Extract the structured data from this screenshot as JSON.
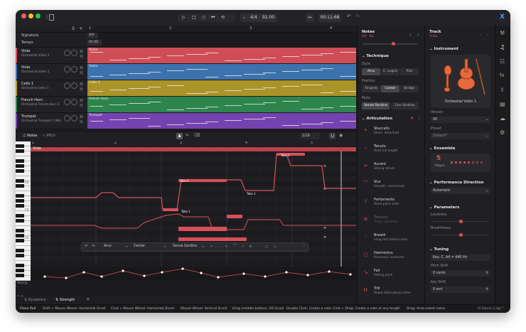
{
  "transport": {
    "time_signature": "4/4",
    "tempo": "92.00",
    "position": "00:11:68"
  },
  "timeline": {
    "bars": [
      "1",
      "2",
      "3",
      "4"
    ],
    "signature_label": "Signature",
    "signature_value": "4/4",
    "tempo_label": "Tempo",
    "tempo_value": "92.00"
  },
  "tracks": [
    {
      "name": "Viola",
      "instrument": "Orchestral Violin 1",
      "color": "#d9505a",
      "clip": "Violin"
    },
    {
      "name": "Viola",
      "instrument": "Orchestral Violin 1",
      "color": "#3f78b5",
      "clip": "Violin"
    },
    {
      "name": "Cello 1",
      "instrument": "Orchestral Cello 1",
      "color": "#b39a2a",
      "clip": "Cello 1"
    },
    {
      "name": "French Horn",
      "instrument": "Orchestral French Horn 1",
      "color": "#2f8a4f",
      "clip": "French Horn"
    },
    {
      "name": "Trumpet",
      "instrument": "Orchestral Trumpet 1 (Bb)",
      "color": "#7a46b8",
      "clip": "Trumpet"
    }
  ],
  "editor": {
    "tabs": [
      "Notes",
      "Pitch"
    ],
    "grid": "1/16",
    "bars": [
      "1",
      "2",
      "3",
      "4",
      "5"
    ],
    "clip_label": "Viola",
    "key_labels": [
      "C6",
      "C5",
      "C4"
    ],
    "note_labels": [
      "Take 1",
      "Take 2",
      "Take 1",
      "Take 1"
    ],
    "float_toolbar": {
      "articulation": "Arco",
      "position": "Center",
      "mute": "Senza Sordino"
    },
    "lane_label": "Strong",
    "lane_label2": "Soft",
    "bottom_tabs": [
      "Dynamics",
      "Strength"
    ]
  },
  "notes_panel": {
    "title": "Notes",
    "subtitle": "A4 · Bb",
    "technique_title": "Technique",
    "style_label": "Style",
    "style_options": [
      "Arco",
      "C. Legno",
      "Pizz"
    ],
    "position_label": "Position",
    "position_options": [
      "Fingerb",
      "Center",
      "Bridge"
    ],
    "mute_label": "Mute",
    "mute_options": [
      "Senza Sordino",
      "Con Sordino"
    ],
    "articulation_title": "Articulation",
    "articulations": [
      {
        "name": "Staccato",
        "desc": "Short, detached",
        "icon": "•"
      },
      {
        "name": "Tenuto",
        "desc": "Held full length",
        "icon": "–"
      },
      {
        "name": "Accent",
        "desc": "Strong attack",
        "icon": ">"
      },
      {
        "name": "Slur",
        "desc": "Smooth, connected",
        "icon": "⌒"
      },
      {
        "name": "Portamento",
        "desc": "Bend pitch slide",
        "icon": "/"
      },
      {
        "name": "Tremolo",
        "desc": "Rapid repetition",
        "icon": "≡"
      },
      {
        "name": "Breath",
        "desc": "Long rest before note",
        "icon": "◦"
      },
      {
        "name": "Harmonics",
        "desc": "Harmonic overtone",
        "icon": "○"
      },
      {
        "name": "Fall",
        "desc": "Falling pitch",
        "icon": "↘"
      },
      {
        "name": "Trill",
        "desc": "Rapid alternating notes",
        "icon": "tr"
      }
    ]
  },
  "track_panel": {
    "title": "Track",
    "subtitle": "Viola",
    "instrument_title": "Instrument",
    "instrument_name": "Orchestral Violin 1",
    "version_label": "Version",
    "version_value": "90",
    "preset_label": "Preset",
    "preset_value": "Default*",
    "ensemble_title": "Ensemble",
    "ensemble_count": "5",
    "ensemble_unit": "Player",
    "direction_title": "Performance Direction",
    "direction_value": "Automatic",
    "params_title": "Parameters",
    "param_loudness": "Loudness",
    "param_breathiness": "Breathiness",
    "tuning_title": "Tuning",
    "tuning_key": "Key: C, A4 = 440 Hz",
    "pitch_shift_label": "Pitch Shift",
    "pitch_shift_value": "0 cents",
    "key_shift_label": "Key Shift",
    "key_shift_value": "0 smi"
  },
  "status_bar": {
    "mode": "Piano Roll",
    "hints": [
      "Shift + Mouse Wheel: Horizontal Scroll",
      "Cmd + Mouse Wheel: Horizontal Zoom",
      "Mouse Wheel: Vertical Scroll",
      "Drag (middle button): 2D Scroll",
      "Double Click: Create a note",
      "Cmd + Drag: Create a note of any length",
      "Drag: Area-select notes"
    ],
    "project": "IX Demo 2.iap *"
  },
  "colors": {
    "accent": "#e0505a",
    "background": "#1c1c1f",
    "note": "#d9505a"
  }
}
